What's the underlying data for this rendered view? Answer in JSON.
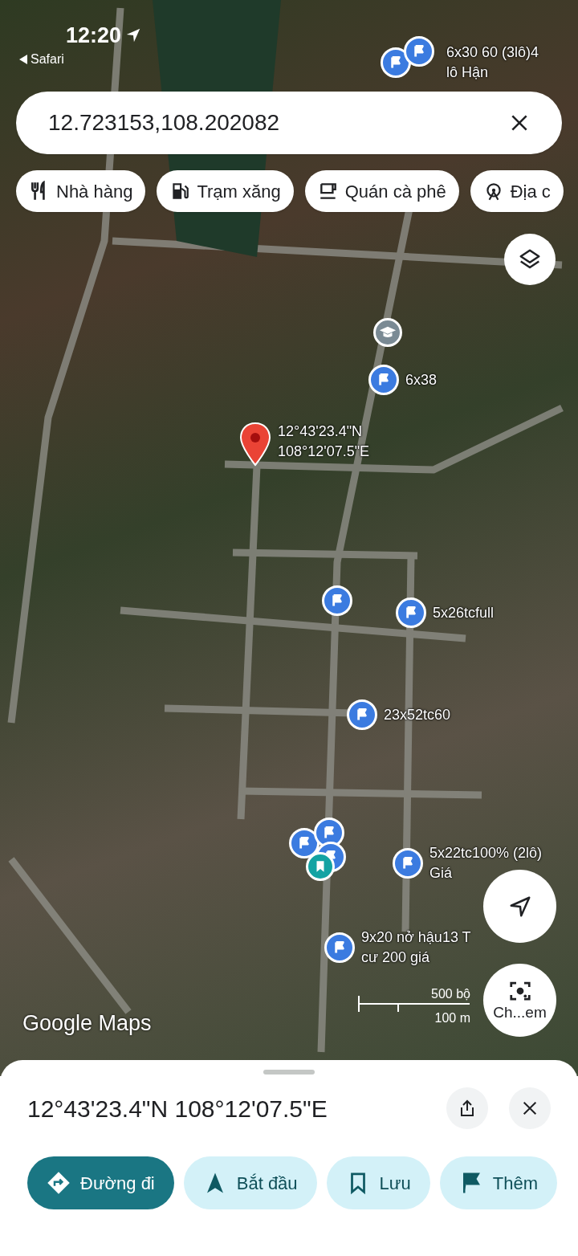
{
  "status_bar": {
    "time": "12:20",
    "back_app": "Safari"
  },
  "search": {
    "value": "12.723153,108.202082"
  },
  "chips": [
    {
      "kind": "restaurant",
      "label": "Nhà hàng"
    },
    {
      "kind": "gas",
      "label": "Trạm xăng"
    },
    {
      "kind": "cafe",
      "label": "Quán cà phê"
    },
    {
      "kind": "attraction",
      "label": "Địa c"
    }
  ],
  "pins": [
    {
      "kind": "flag",
      "label": [
        "6x30 60 (3lô)4",
        "lô Hận"
      ]
    },
    {
      "kind": "flag"
    },
    {
      "kind": "school"
    },
    {
      "kind": "flag",
      "label": [
        "6x38"
      ]
    },
    {
      "kind": "dropped",
      "label": [
        "12°43'23.4\"N",
        "108°12'07.5\"E"
      ]
    },
    {
      "kind": "flag"
    },
    {
      "kind": "flag",
      "label": [
        "5x26tcfull"
      ]
    },
    {
      "kind": "flag",
      "label": [
        "23x52tc60"
      ]
    },
    {
      "kind": "flag"
    },
    {
      "kind": "flag"
    },
    {
      "kind": "flag"
    },
    {
      "kind": "saved"
    },
    {
      "kind": "flag",
      "label": [
        "5x22tc100% (2lô)",
        "Giá"
      ]
    },
    {
      "kind": "flag",
      "label": [
        "9x20 nở hậu13 T",
        "cư 200 giá"
      ]
    }
  ],
  "map_logo": "Google Maps",
  "scale": {
    "imperial": "500 bộ",
    "metric": "100 m"
  },
  "lens_button": "Ch...em",
  "place": {
    "title": "12°43'23.4\"N 108°12'07.5\"E"
  },
  "actions": [
    {
      "kind": "directions",
      "label": "Đường đi",
      "filled": true
    },
    {
      "kind": "start",
      "label": "Bắt đầu",
      "filled": false
    },
    {
      "kind": "save",
      "label": "Lưu",
      "filled": false
    },
    {
      "kind": "label",
      "label": "Thêm",
      "filled": false
    }
  ]
}
